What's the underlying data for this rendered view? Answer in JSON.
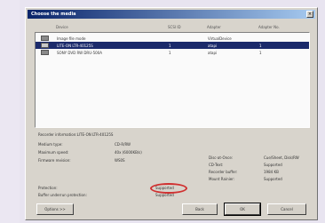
{
  "dialog": {
    "title": "Choose the media"
  },
  "columns": [
    "Device",
    "SCSI ID",
    "Adapter",
    "Adapter No."
  ],
  "devices": [
    {
      "device": "Image file mode",
      "scsi_id": "",
      "adapter": "VirtualDevice",
      "adapter_no": "",
      "selected": false
    },
    {
      "device": "LITE-ON LTR-40125S",
      "scsi_id": "1",
      "adapter": "atapi",
      "adapter_no": "1",
      "selected": true
    },
    {
      "device": "SONY DVD RW DRU-500A",
      "scsi_id": "1",
      "adapter": "atapi",
      "adapter_no": "1",
      "selected": false
    }
  ],
  "info": {
    "title": "Recorder information:LITE-ON LTR-40125S",
    "left": [
      {
        "label": "Medium type:",
        "value": "CD-R/RW"
      },
      {
        "label": "Maximum speed:",
        "value": "40x (6000KB/s)"
      },
      {
        "label": "Firmware revision:",
        "value": "WS0S"
      },
      {
        "label": "Protection:",
        "value": "Supported"
      },
      {
        "label": "Buffer underrun protection:",
        "value": "Supported"
      }
    ],
    "right": [
      {
        "label": "Disc-at-Once:",
        "value": "Cue/Sheet, Disk/RW"
      },
      {
        "label": "CD-Text:",
        "value": "Supported"
      },
      {
        "label": "Recorder buffer:",
        "value": "1984 KB"
      },
      {
        "label": "Mount Rainier:",
        "value": "Supported"
      }
    ]
  },
  "buttons": {
    "options": "Options >>",
    "back": "Back",
    "ok": "OK",
    "cancel": "Cancel"
  }
}
